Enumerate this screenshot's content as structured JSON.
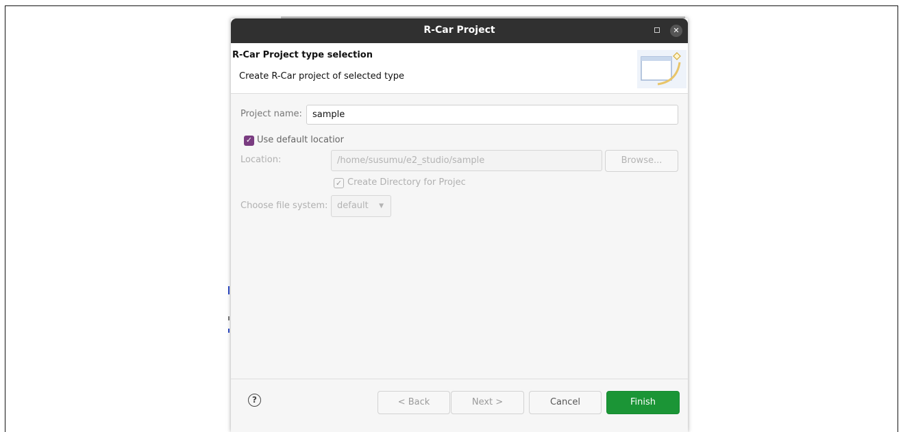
{
  "dialog": {
    "title": "R-Car Project",
    "banner": {
      "title": "R-Car Project type selection",
      "subtitle": "Create R-Car project of selected type"
    },
    "project_name": {
      "label": "Project name:",
      "value": "sample"
    },
    "use_default_location": {
      "label": "Use default locatior",
      "checked": true
    },
    "location": {
      "label": "Location:",
      "value": "/home/susumu/e2_studio/sample",
      "browse_label": "Browse..."
    },
    "create_directory": {
      "label": "Create Directory for Projec",
      "checked": true
    },
    "file_system": {
      "label": "Choose file system:",
      "selected": "default"
    },
    "buttons": {
      "back": "< Back",
      "next": "Next >",
      "cancel": "Cancel",
      "finish": "Finish"
    }
  },
  "colors": {
    "titlebar": "#303030",
    "checkbox_accent": "#7a3c81",
    "finish_button": "#1b9536"
  },
  "icons": [
    "maximize-icon",
    "close-icon",
    "wizard-banner-icon",
    "checkmark-icon",
    "dropdown-arrow-icon",
    "help-icon"
  ]
}
